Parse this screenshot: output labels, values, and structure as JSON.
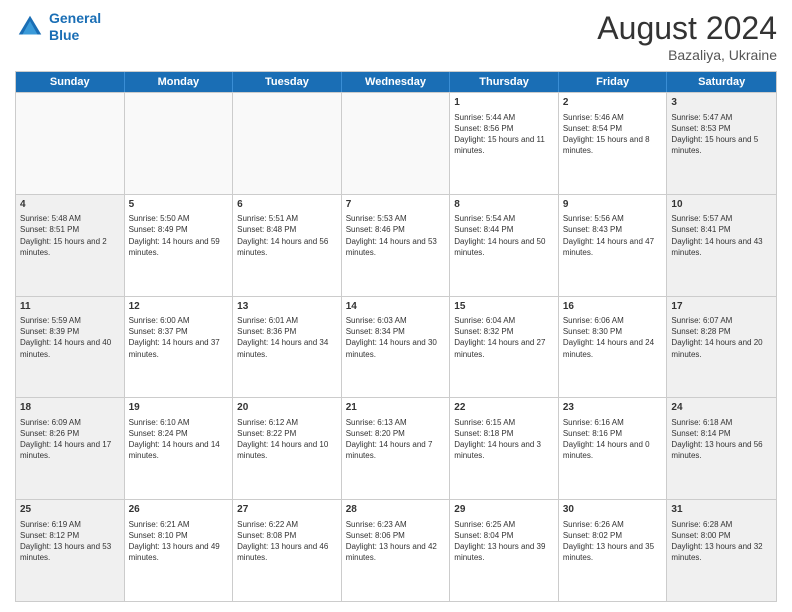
{
  "header": {
    "logo_line1": "General",
    "logo_line2": "Blue",
    "month": "August 2024",
    "location": "Bazaliya, Ukraine"
  },
  "days_of_week": [
    "Sunday",
    "Monday",
    "Tuesday",
    "Wednesday",
    "Thursday",
    "Friday",
    "Saturday"
  ],
  "weeks": [
    [
      {
        "day": "",
        "info": ""
      },
      {
        "day": "",
        "info": ""
      },
      {
        "day": "",
        "info": ""
      },
      {
        "day": "",
        "info": ""
      },
      {
        "day": "1",
        "info": "Sunrise: 5:44 AM\nSunset: 8:56 PM\nDaylight: 15 hours and 11 minutes."
      },
      {
        "day": "2",
        "info": "Sunrise: 5:46 AM\nSunset: 8:54 PM\nDaylight: 15 hours and 8 minutes."
      },
      {
        "day": "3",
        "info": "Sunrise: 5:47 AM\nSunset: 8:53 PM\nDaylight: 15 hours and 5 minutes."
      }
    ],
    [
      {
        "day": "4",
        "info": "Sunrise: 5:48 AM\nSunset: 8:51 PM\nDaylight: 15 hours and 2 minutes."
      },
      {
        "day": "5",
        "info": "Sunrise: 5:50 AM\nSunset: 8:49 PM\nDaylight: 14 hours and 59 minutes."
      },
      {
        "day": "6",
        "info": "Sunrise: 5:51 AM\nSunset: 8:48 PM\nDaylight: 14 hours and 56 minutes."
      },
      {
        "day": "7",
        "info": "Sunrise: 5:53 AM\nSunset: 8:46 PM\nDaylight: 14 hours and 53 minutes."
      },
      {
        "day": "8",
        "info": "Sunrise: 5:54 AM\nSunset: 8:44 PM\nDaylight: 14 hours and 50 minutes."
      },
      {
        "day": "9",
        "info": "Sunrise: 5:56 AM\nSunset: 8:43 PM\nDaylight: 14 hours and 47 minutes."
      },
      {
        "day": "10",
        "info": "Sunrise: 5:57 AM\nSunset: 8:41 PM\nDaylight: 14 hours and 43 minutes."
      }
    ],
    [
      {
        "day": "11",
        "info": "Sunrise: 5:59 AM\nSunset: 8:39 PM\nDaylight: 14 hours and 40 minutes."
      },
      {
        "day": "12",
        "info": "Sunrise: 6:00 AM\nSunset: 8:37 PM\nDaylight: 14 hours and 37 minutes."
      },
      {
        "day": "13",
        "info": "Sunrise: 6:01 AM\nSunset: 8:36 PM\nDaylight: 14 hours and 34 minutes."
      },
      {
        "day": "14",
        "info": "Sunrise: 6:03 AM\nSunset: 8:34 PM\nDaylight: 14 hours and 30 minutes."
      },
      {
        "day": "15",
        "info": "Sunrise: 6:04 AM\nSunset: 8:32 PM\nDaylight: 14 hours and 27 minutes."
      },
      {
        "day": "16",
        "info": "Sunrise: 6:06 AM\nSunset: 8:30 PM\nDaylight: 14 hours and 24 minutes."
      },
      {
        "day": "17",
        "info": "Sunrise: 6:07 AM\nSunset: 8:28 PM\nDaylight: 14 hours and 20 minutes."
      }
    ],
    [
      {
        "day": "18",
        "info": "Sunrise: 6:09 AM\nSunset: 8:26 PM\nDaylight: 14 hours and 17 minutes."
      },
      {
        "day": "19",
        "info": "Sunrise: 6:10 AM\nSunset: 8:24 PM\nDaylight: 14 hours and 14 minutes."
      },
      {
        "day": "20",
        "info": "Sunrise: 6:12 AM\nSunset: 8:22 PM\nDaylight: 14 hours and 10 minutes."
      },
      {
        "day": "21",
        "info": "Sunrise: 6:13 AM\nSunset: 8:20 PM\nDaylight: 14 hours and 7 minutes."
      },
      {
        "day": "22",
        "info": "Sunrise: 6:15 AM\nSunset: 8:18 PM\nDaylight: 14 hours and 3 minutes."
      },
      {
        "day": "23",
        "info": "Sunrise: 6:16 AM\nSunset: 8:16 PM\nDaylight: 14 hours and 0 minutes."
      },
      {
        "day": "24",
        "info": "Sunrise: 6:18 AM\nSunset: 8:14 PM\nDaylight: 13 hours and 56 minutes."
      }
    ],
    [
      {
        "day": "25",
        "info": "Sunrise: 6:19 AM\nSunset: 8:12 PM\nDaylight: 13 hours and 53 minutes."
      },
      {
        "day": "26",
        "info": "Sunrise: 6:21 AM\nSunset: 8:10 PM\nDaylight: 13 hours and 49 minutes."
      },
      {
        "day": "27",
        "info": "Sunrise: 6:22 AM\nSunset: 8:08 PM\nDaylight: 13 hours and 46 minutes."
      },
      {
        "day": "28",
        "info": "Sunrise: 6:23 AM\nSunset: 8:06 PM\nDaylight: 13 hours and 42 minutes."
      },
      {
        "day": "29",
        "info": "Sunrise: 6:25 AM\nSunset: 8:04 PM\nDaylight: 13 hours and 39 minutes."
      },
      {
        "day": "30",
        "info": "Sunrise: 6:26 AM\nSunset: 8:02 PM\nDaylight: 13 hours and 35 minutes."
      },
      {
        "day": "31",
        "info": "Sunrise: 6:28 AM\nSunset: 8:00 PM\nDaylight: 13 hours and 32 minutes."
      }
    ]
  ]
}
